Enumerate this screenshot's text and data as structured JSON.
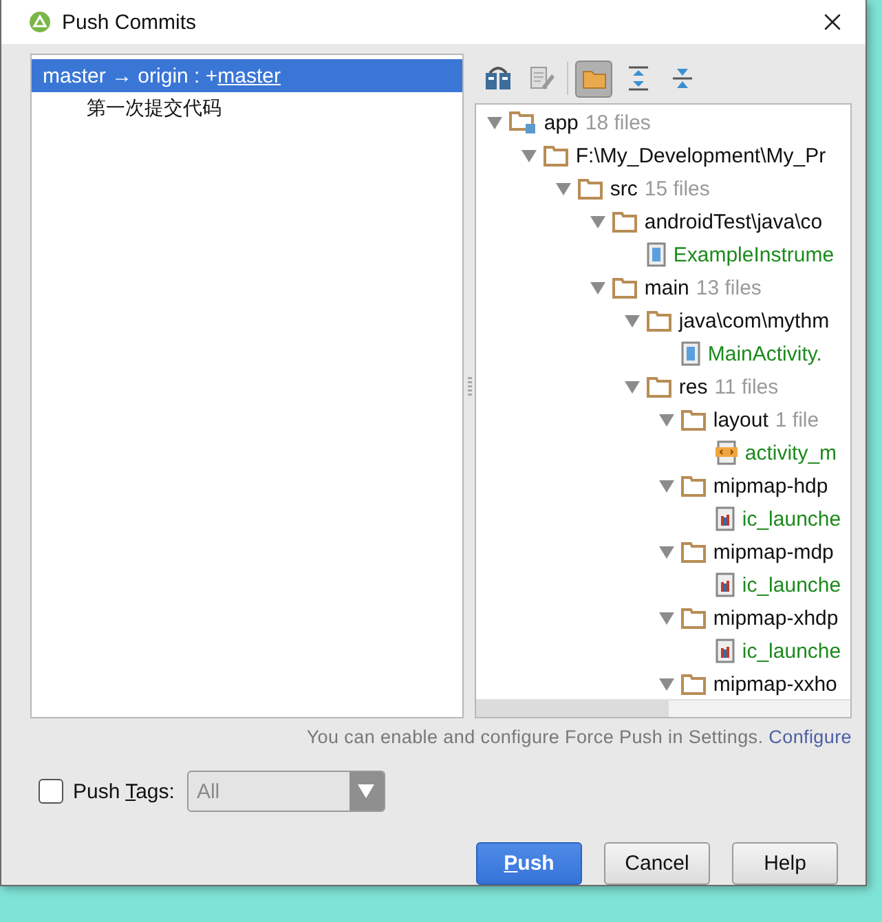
{
  "window": {
    "title": "Push Commits"
  },
  "branches": [
    {
      "source": "master → origin : +",
      "target": "master",
      "selected": true,
      "commits": [
        "第一次提交代码"
      ]
    }
  ],
  "toolbar": [
    {
      "kind": "diff",
      "selected": false
    },
    {
      "kind": "edit",
      "selected": false
    },
    {
      "kind": "group",
      "selected": true
    },
    {
      "kind": "expand",
      "selected": false
    },
    {
      "kind": "collapse",
      "selected": false
    }
  ],
  "tree": [
    {
      "kind": "module",
      "name": "app",
      "count": "18 files",
      "expanded": true,
      "children": [
        {
          "kind": "folder",
          "name": "F:\\My_Development\\My_Pr",
          "expanded": true,
          "children": [
            {
              "kind": "folder",
              "name": "src",
              "count": "15 files",
              "expanded": true,
              "children": [
                {
                  "kind": "folder",
                  "name": "androidTest\\java\\co",
                  "expanded": true,
                  "children": [
                    {
                      "kind": "java_file",
                      "added": true,
                      "name": "ExampleInstrume"
                    }
                  ]
                },
                {
                  "kind": "folder",
                  "name": "main",
                  "count": "13 files",
                  "expanded": true,
                  "children": [
                    {
                      "kind": "folder",
                      "name": "java\\com\\mythm",
                      "expanded": true,
                      "children": [
                        {
                          "kind": "java_file",
                          "added": true,
                          "name": "MainActivity."
                        }
                      ]
                    },
                    {
                      "kind": "folder",
                      "name": "res",
                      "count": "11 files",
                      "expanded": true,
                      "children": [
                        {
                          "kind": "folder",
                          "name": "layout",
                          "count": "1 file",
                          "expanded": true,
                          "children": [
                            {
                              "kind": "xml_file",
                              "added": true,
                              "name": "activity_m"
                            }
                          ]
                        },
                        {
                          "kind": "folder",
                          "name": "mipmap-hdp",
                          "expanded": true,
                          "children": [
                            {
                              "kind": "image_file",
                              "added": true,
                              "name": "ic_launche"
                            }
                          ]
                        },
                        {
                          "kind": "folder",
                          "name": "mipmap-mdp",
                          "expanded": true,
                          "children": [
                            {
                              "kind": "image_file",
                              "added": true,
                              "name": "ic_launche"
                            }
                          ]
                        },
                        {
                          "kind": "folder",
                          "name": "mipmap-xhdp",
                          "expanded": true,
                          "children": [
                            {
                              "kind": "image_file",
                              "added": true,
                              "name": "ic_launche"
                            }
                          ]
                        },
                        {
                          "kind": "folder",
                          "name": "mipmap-xxho",
                          "expanded": true
                        }
                      ]
                    }
                  ]
                }
              ]
            }
          ]
        }
      ]
    }
  ],
  "force_push_note": {
    "text": "You can enable and configure Force Push in Settings.",
    "link": "Configure"
  },
  "push_tags": {
    "checked": false,
    "label_before": "Push ",
    "mnemonic": "T",
    "label_after": "ags:",
    "value": "All",
    "disabled": true
  },
  "buttons": [
    {
      "kind": "primary",
      "mnemonic": "P",
      "rest": "ush"
    },
    {
      "kind": "normal",
      "rest": "Cancel"
    },
    {
      "kind": "normal",
      "rest": "Help"
    }
  ]
}
